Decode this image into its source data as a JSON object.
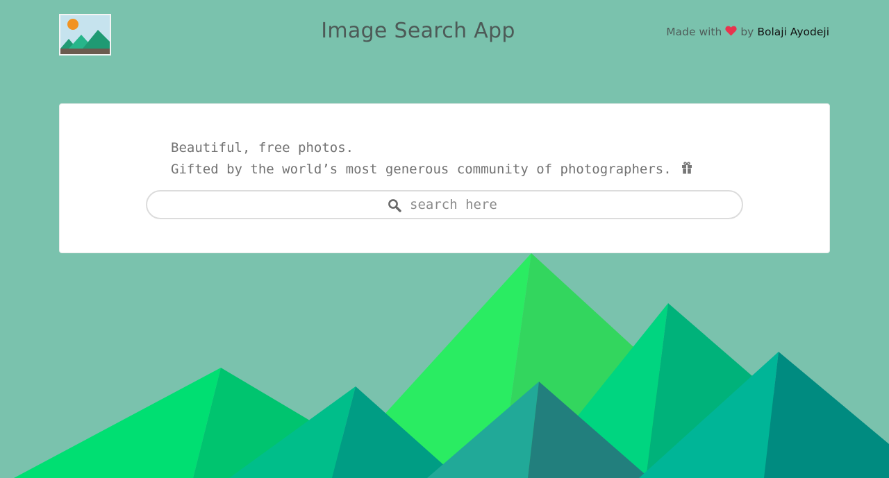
{
  "header": {
    "logo_name": "landscape-image-logo",
    "title": "Image Search App",
    "credit": {
      "made_with": "Made with",
      "heart_icon": "heart-icon",
      "by": "by",
      "author": "Bolaji Ayodeji"
    }
  },
  "hero": {
    "tagline_line1": "Beautiful, free photos.",
    "tagline_line2": "Gifted by the world’s most generous community of photographers.",
    "gift_icon": "gift-icon"
  },
  "search": {
    "icon": "search-icon",
    "placeholder": "search here",
    "value": ""
  },
  "colors": {
    "background": "#7ac2ad",
    "heart": "#e8344e",
    "mountain_bright_green": "#2aec62",
    "mountain_green": "#00d977",
    "mountain_teal": "#00b597",
    "mountain_dark_teal": "#208080",
    "logo_sun": "#f19322"
  }
}
